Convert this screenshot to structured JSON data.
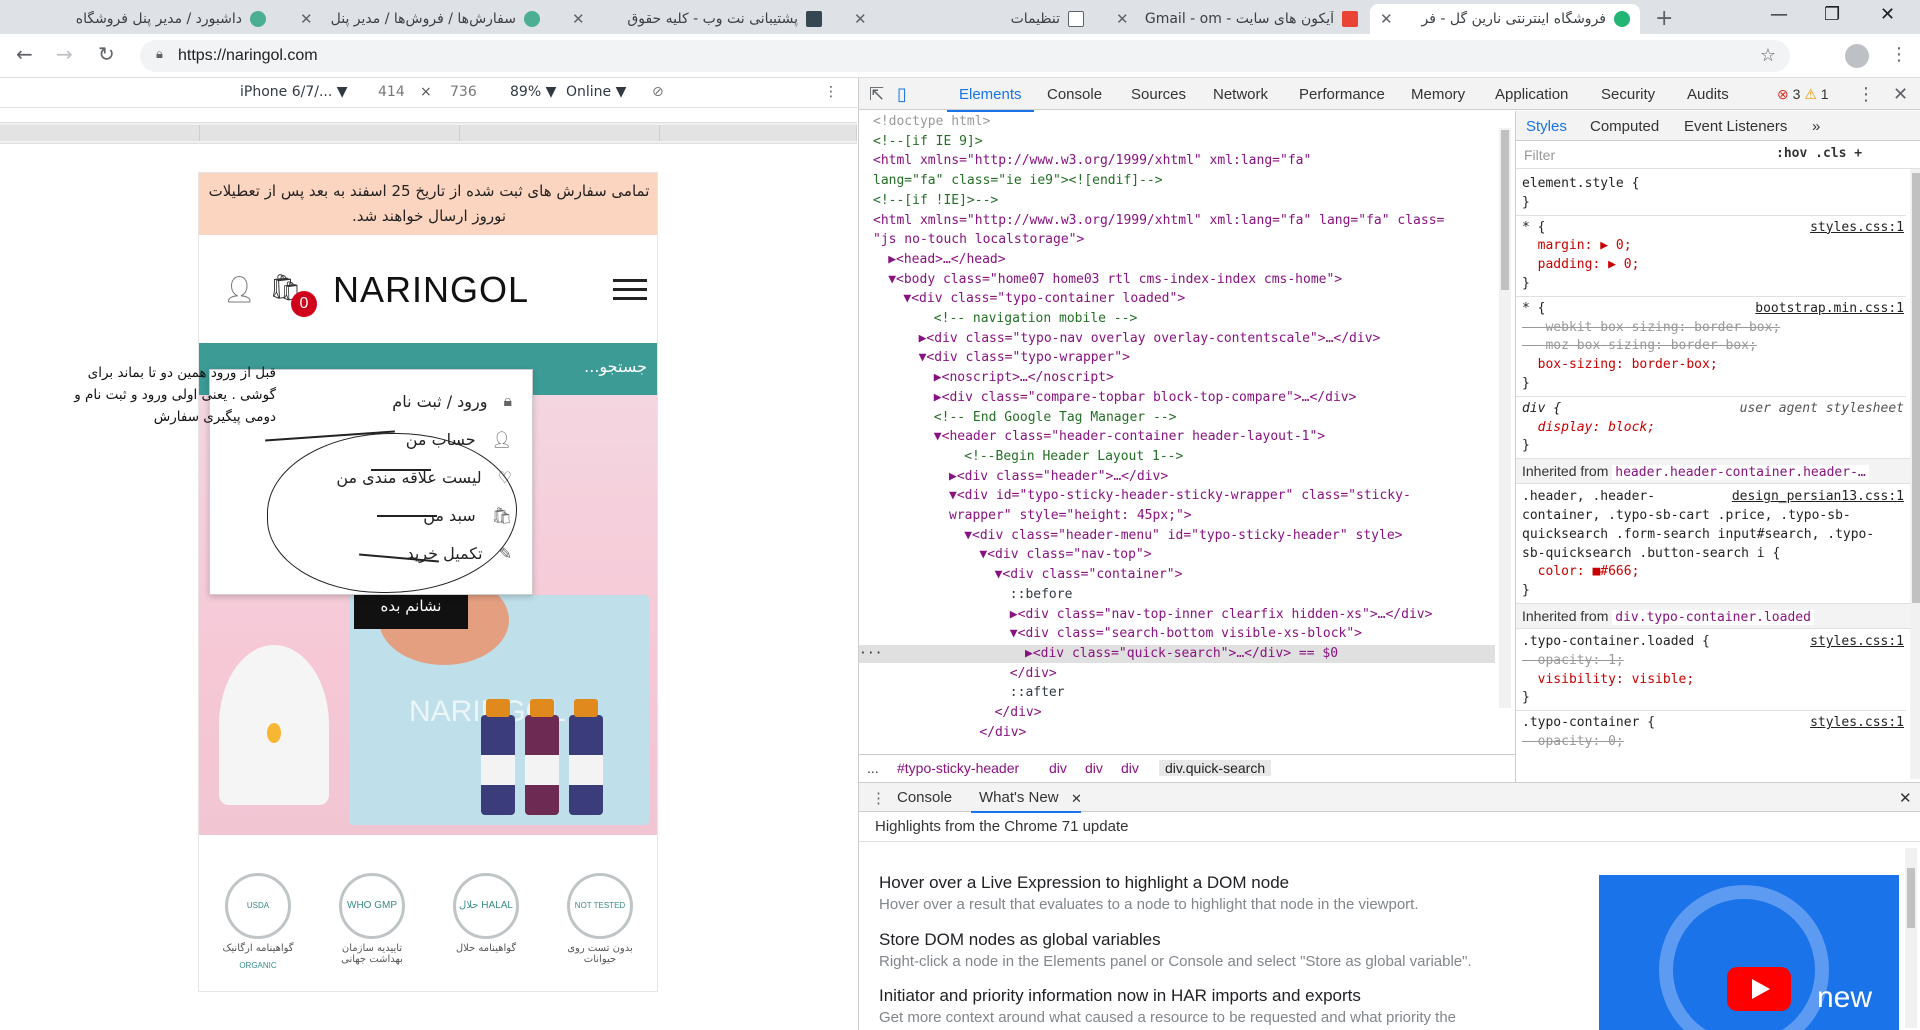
{
  "browser": {
    "tabs": [
      {
        "title": "داشبورد / مدیر پنل فروشگاه",
        "color": "#4caf93"
      },
      {
        "title": "سفارش‌ها / فروش‌ها / مدیر پنل",
        "color": "#4caf93"
      },
      {
        "title": "پشتیبانی نت وب - کلیه حقوق",
        "color": "#37474f"
      },
      {
        "title": "تنظیمات",
        "color": "#5f6368"
      },
      {
        "title": "آیکون های سایت - Gmail - ‎om",
        "color": "#ea4335"
      },
      {
        "title": "فروشگاه اینترنتی نارین گل - فر",
        "color": "#22b573"
      }
    ],
    "new_tab_icon": "+",
    "url": "https://naringol.com"
  },
  "device_toolbar": {
    "device": "iPhone 6/7/...",
    "width": "414",
    "times": "×",
    "height": "736",
    "zoom": "89%",
    "network": "Online"
  },
  "site": {
    "notice": "تمامی سفارش های ثبت شده از تاریخ 25 اسفند به بعد پس از تعطیلات نوروز ارسال خواهند شد.",
    "logo": "NARINGOL",
    "cart_count": "0",
    "search_placeholder": "جستجو...",
    "banner_brand": "NARINGOL",
    "show_button": "نشانم بده",
    "account_menu": [
      {
        "label": "ورود / ثبت نام",
        "icon": "lock-icon"
      },
      {
        "label": "حساب من",
        "icon": "user-icon"
      },
      {
        "label": "لیست علاقه مندی من",
        "icon": "heart-icon"
      },
      {
        "label": "سبد من",
        "icon": "bag-icon"
      },
      {
        "label": "تکمیل خرید",
        "icon": "edit-icon"
      }
    ],
    "badges": [
      {
        "seal": "USDA ORGANIC",
        "caption": "گواهینامه ارگانیک"
      },
      {
        "seal": "WHO GMP",
        "caption": "تاییدیه سازمان بهداشت جهانی"
      },
      {
        "seal": "حلال HALAL",
        "caption": "گواهینامه حلال"
      },
      {
        "seal": "NOT TESTED",
        "caption": "بدون تست روی حیوانات"
      }
    ],
    "annotation": "قبل از ورود همین دو تا بماند برای گوشی . یعنی اولی ورود و ثبت نام و دومی پیگیری سفارش"
  },
  "devtools": {
    "tabs": [
      "Elements",
      "Console",
      "Sources",
      "Network",
      "Performance",
      "Memory",
      "Application",
      "Security",
      "Audits"
    ],
    "errors": "3",
    "warnings": "1",
    "dom_lines": [
      {
        "indent": 0,
        "text": "<!doctype html>",
        "kind": "doctype"
      },
      {
        "indent": 0,
        "text": "<!--[if IE 9]>",
        "kind": "comment"
      },
      {
        "indent": 0,
        "text": "<html xmlns=\"http://www.w3.org/1999/xhtml\" xml:lang=\"fa\"",
        "kind": "tag"
      },
      {
        "indent": 0,
        "text": "lang=\"fa\" class=\"ie ie9\"><![endif]-->",
        "kind": "comment"
      },
      {
        "indent": 0,
        "text": "<!--[if !IE]>-->",
        "kind": "comment"
      },
      {
        "indent": 0,
        "text": "<html xmlns=\"http://www.w3.org/1999/xhtml\" xml:lang=\"fa\" lang=\"fa\" class=",
        "kind": "tag"
      },
      {
        "indent": 0,
        "text": "\"js no-touch localstorage\">",
        "kind": "tag"
      },
      {
        "indent": 1,
        "text": "▶<head>…</head>",
        "kind": "tag"
      },
      {
        "indent": 1,
        "text": "▼<body class=\"home07 home03 rtl cms-index-index cms-home\">",
        "kind": "tag"
      },
      {
        "indent": 2,
        "text": "▼<div class=\"typo-container loaded\">",
        "kind": "tag"
      },
      {
        "indent": 4,
        "text": "<!-- navigation mobile -->",
        "kind": "comment"
      },
      {
        "indent": 3,
        "text": "▶<div class=\"typo-nav overlay overlay-contentscale\">…</div>",
        "kind": "tag"
      },
      {
        "indent": 3,
        "text": "▼<div class=\"typo-wrapper\">",
        "kind": "tag"
      },
      {
        "indent": 4,
        "text": "▶<noscript>…</noscript>",
        "kind": "tag"
      },
      {
        "indent": 4,
        "text": "▶<div class=\"compare-topbar block-top-compare\">…</div>",
        "kind": "tag"
      },
      {
        "indent": 4,
        "text": "<!-- End Google Tag Manager -->",
        "kind": "comment"
      },
      {
        "indent": 4,
        "text": "▼<header class=\"header-container header-layout-1\">",
        "kind": "tag"
      },
      {
        "indent": 6,
        "text": "<!--Begin Header Layout 1-->",
        "kind": "comment"
      },
      {
        "indent": 5,
        "text": "▶<div class=\"header\">…</div>",
        "kind": "tag"
      },
      {
        "indent": 5,
        "text": "▼<div id=\"typo-sticky-header-sticky-wrapper\" class=\"sticky-",
        "kind": "tag"
      },
      {
        "indent": 5,
        "text": "wrapper\" style=\"height: 45px;\">",
        "kind": "tag"
      },
      {
        "indent": 6,
        "text": "▼<div class=\"header-menu\" id=\"typo-sticky-header\" style>",
        "kind": "tag"
      },
      {
        "indent": 7,
        "text": "▼<div class=\"nav-top\">",
        "kind": "tag"
      },
      {
        "indent": 8,
        "text": "▼<div class=\"container\">",
        "kind": "tag"
      },
      {
        "indent": 9,
        "text": "::before",
        "kind": "text"
      },
      {
        "indent": 9,
        "text": "▶<div class=\"nav-top-inner clearfix hidden-xs\">…</div>",
        "kind": "tag"
      },
      {
        "indent": 9,
        "text": "▼<div class=\"search-bottom visible-xs-block\">",
        "kind": "tag"
      },
      {
        "indent": 10,
        "text": "▶<div class=\"quick-search\">…</div> == $0",
        "kind": "tag",
        "selected": true
      },
      {
        "indent": 9,
        "text": "</div>",
        "kind": "tag"
      },
      {
        "indent": 9,
        "text": "::after",
        "kind": "text"
      },
      {
        "indent": 8,
        "text": "</div>",
        "kind": "tag"
      },
      {
        "indent": 7,
        "text": "</div>",
        "kind": "tag"
      }
    ],
    "breadcrumbs": [
      "...",
      "#typo-sticky-header",
      "div",
      "div",
      "div",
      "div.quick-search"
    ],
    "styles_tabs": [
      "Styles",
      "Computed",
      "Event Listeners",
      "»"
    ],
    "filter_placeholder": "Filter",
    "filter_opts": ":hov  .cls  +",
    "styles": [
      {
        "text": "element.style {",
        "kind": "sel"
      },
      {
        "text": "}",
        "kind": "sel"
      },
      {
        "text": "* {",
        "kind": "sel",
        "src": "styles.css:1"
      },
      {
        "text": "  margin: ▶ 0;",
        "kind": "prop"
      },
      {
        "text": "  padding: ▶ 0;",
        "kind": "prop"
      },
      {
        "text": "}",
        "kind": "sel"
      },
      {
        "text": "* {",
        "kind": "sel",
        "src": "bootstrap.min.css:1"
      },
      {
        "text": "  -webkit-box-sizing: border-box;",
        "kind": "strike"
      },
      {
        "text": "  -moz-box-sizing: border-box;",
        "kind": "strike"
      },
      {
        "text": "  box-sizing: border-box;",
        "kind": "prop"
      },
      {
        "text": "}",
        "kind": "sel"
      },
      {
        "text": "div {",
        "kind": "ital",
        "ua": "user agent stylesheet"
      },
      {
        "text": "  display: block;",
        "kind": "italprop"
      },
      {
        "text": "}",
        "kind": "sel"
      }
    ],
    "inherited1": {
      "label": "Inherited from",
      "selector": "header.header-container.header-…"
    },
    "styles2": [
      {
        "text": ".header, .header-",
        "kind": "sel",
        "src": "design_persian13.css:1"
      },
      {
        "text": "container, .typo-sb-cart .price, .typo-sb-",
        "kind": "sel"
      },
      {
        "text": "quicksearch .form-search input#search, .typo-",
        "kind": "sel"
      },
      {
        "text": "sb-quicksearch .button-search i {",
        "kind": "sel"
      },
      {
        "text": "  color: ■#666;",
        "kind": "prop"
      },
      {
        "text": "}",
        "kind": "sel"
      }
    ],
    "inherited2": {
      "label": "Inherited from",
      "selector": "div.typo-container.loaded"
    },
    "styles3": [
      {
        "text": ".typo-container.loaded {",
        "kind": "sel",
        "src": "styles.css:1"
      },
      {
        "text": "  opacity: 1;",
        "kind": "strike"
      },
      {
        "text": "  visibility: visible;",
        "kind": "prop"
      },
      {
        "text": "}",
        "kind": "sel"
      },
      {
        "text": ".typo-container {",
        "kind": "sel",
        "src": "styles.css:1"
      },
      {
        "text": "  opacity: 0;",
        "kind": "strike"
      }
    ],
    "drawer_tabs": [
      "Console",
      "What's New"
    ],
    "whats_new_header": "Highlights from the Chrome 71 update",
    "whats_new": [
      {
        "title": "Hover over a Live Expression to highlight a DOM node",
        "desc": "Hover over a result that evaluates to a node to highlight that node in the viewport."
      },
      {
        "title": "Store DOM nodes as global variables",
        "desc": "Right-click a node in the Elements panel or Console and select \"Store as global variable\"."
      },
      {
        "title": "Initiator and priority information now in HAR imports and exports",
        "desc": "Get more context around what caused a resource to be requested and what priority the"
      }
    ],
    "promo_word": "new"
  }
}
